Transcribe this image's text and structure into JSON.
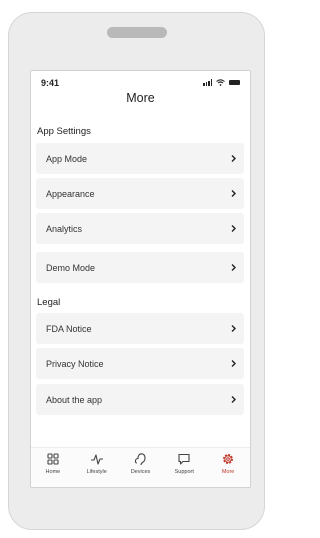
{
  "status": {
    "time": "9:41"
  },
  "header": {
    "title": "More"
  },
  "sections": [
    {
      "title": "App Settings",
      "items": [
        "App Mode",
        "Appearance",
        "Analytics",
        "Demo Mode"
      ]
    },
    {
      "title": "Legal",
      "items": [
        "FDA Notice",
        "Privacy Notice",
        "About the app"
      ]
    }
  ],
  "tabs": [
    {
      "label": "Home",
      "icon": "grid-icon"
    },
    {
      "label": "Lifestyle",
      "icon": "pulse-icon"
    },
    {
      "label": "Devices",
      "icon": "hearing-aid-icon"
    },
    {
      "label": "Support",
      "icon": "chat-bubble-icon"
    },
    {
      "label": "More",
      "icon": "gear-icon",
      "active": true
    }
  ],
  "colors": {
    "accent": "#c0392b",
    "row_bg": "#f4f4f4",
    "frame_bg": "#ececec"
  }
}
